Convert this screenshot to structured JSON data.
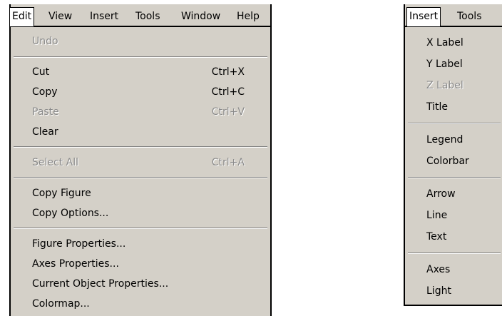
{
  "edit_menu": {
    "menubar": [
      "Edit",
      "View",
      "Insert",
      "Tools",
      "Window",
      "Help"
    ],
    "items": [
      {
        "label": "Undo",
        "shortcut": "",
        "disabled": true
      },
      {
        "label": "Cut",
        "shortcut": "Ctrl+X",
        "disabled": false
      },
      {
        "label": "Copy",
        "shortcut": "Ctrl+C",
        "disabled": false
      },
      {
        "label": "Paste",
        "shortcut": "Ctrl+V",
        "disabled": true
      },
      {
        "label": "Clear",
        "shortcut": "",
        "disabled": false
      },
      {
        "label": "Select All",
        "shortcut": "Ctrl+A",
        "disabled": true
      },
      {
        "label": "Copy Figure",
        "shortcut": "",
        "disabled": false
      },
      {
        "label": "Copy Options...",
        "shortcut": "",
        "disabled": false
      },
      {
        "label": "Figure Properties...",
        "shortcut": "",
        "disabled": false
      },
      {
        "label": "Axes Properties...",
        "shortcut": "",
        "disabled": false
      },
      {
        "label": "Current Object Properties...",
        "shortcut": "",
        "disabled": false
      },
      {
        "label": "Colormap...",
        "shortcut": "",
        "disabled": false
      }
    ]
  },
  "insert_menu": {
    "menubar": [
      "Insert",
      "Tools"
    ],
    "items": [
      {
        "label": "X Label",
        "disabled": false
      },
      {
        "label": "Y Label",
        "disabled": false
      },
      {
        "label": "Z Label",
        "disabled": true
      },
      {
        "label": "Title",
        "disabled": false
      },
      {
        "label": "Legend",
        "disabled": false
      },
      {
        "label": "Colorbar",
        "disabled": false
      },
      {
        "label": "Arrow",
        "disabled": false
      },
      {
        "label": "Line",
        "disabled": false
      },
      {
        "label": "Text",
        "disabled": false
      },
      {
        "label": "Axes",
        "disabled": false
      },
      {
        "label": "Light",
        "disabled": false
      }
    ]
  },
  "colors": {
    "menu_bg": "#d4d0c8",
    "disabled_text": "#8a8a8a"
  }
}
